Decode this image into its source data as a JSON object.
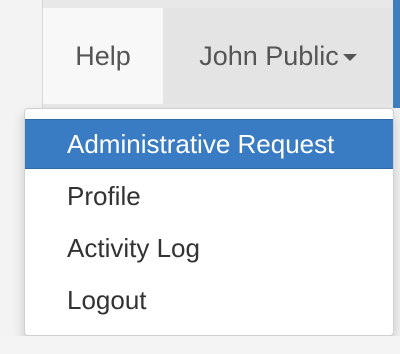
{
  "navbar": {
    "help_label": "Help",
    "user_label": "John Public"
  },
  "dropdown": {
    "items": [
      {
        "label": "Administrative Request",
        "active": true
      },
      {
        "label": "Profile",
        "active": false
      },
      {
        "label": "Activity Log",
        "active": false
      },
      {
        "label": "Logout",
        "active": false
      }
    ]
  },
  "colors": {
    "accent": "#3a7cc4",
    "navbar_bg": "#e8e8e8",
    "text": "#333333"
  },
  "icons": {
    "user_menu": "caret-down-icon"
  }
}
